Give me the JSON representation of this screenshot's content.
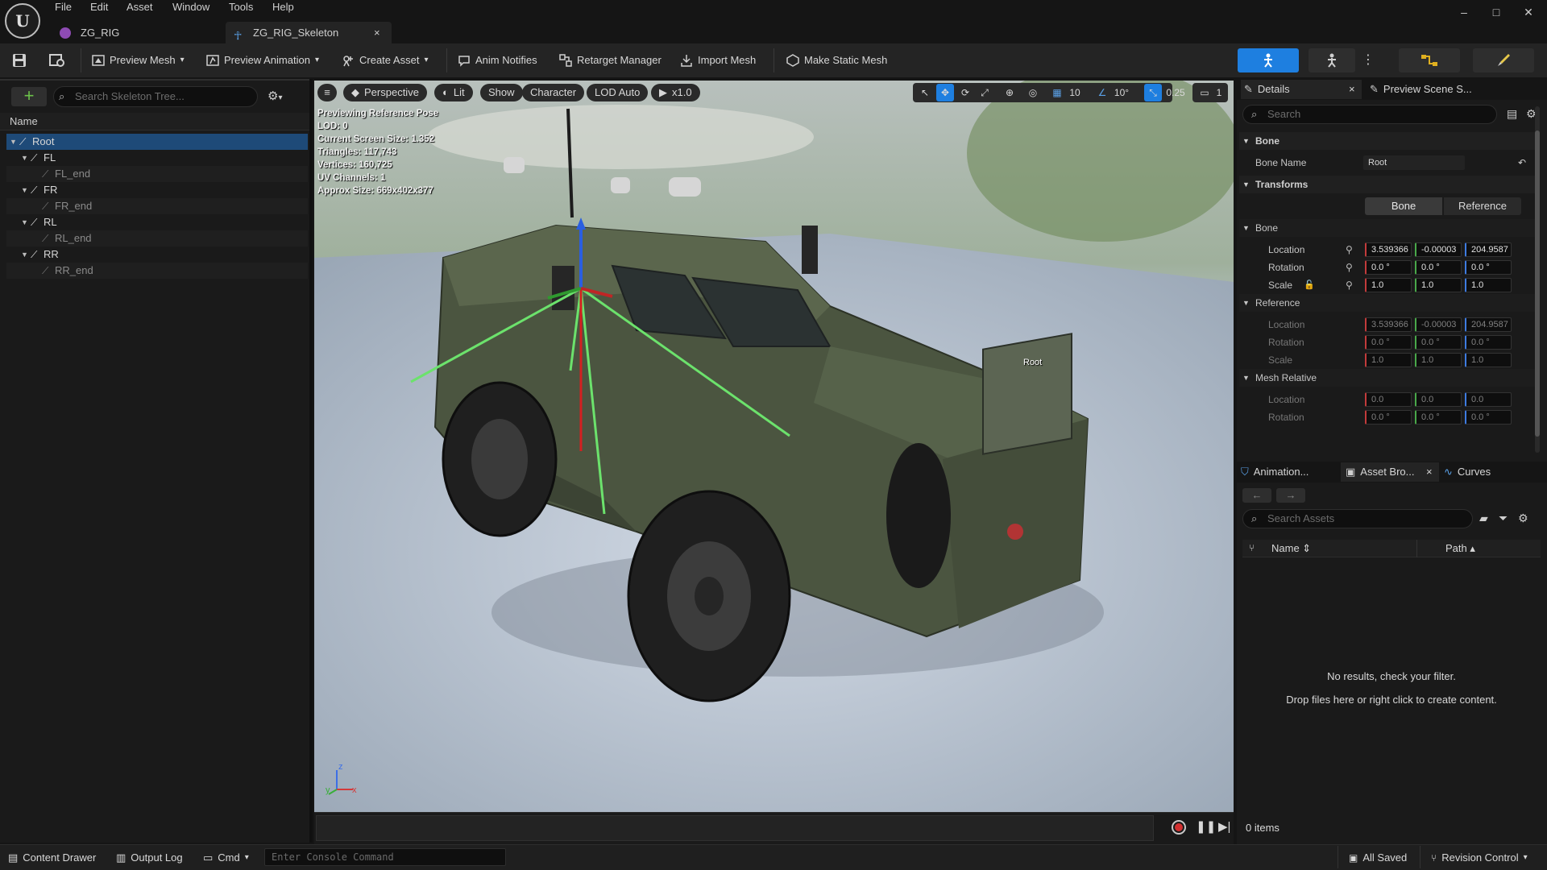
{
  "app": {
    "menu": [
      "File",
      "Edit",
      "Asset",
      "Window",
      "Tools",
      "Help"
    ],
    "tabs": [
      {
        "label": "ZG_RIG"
      },
      {
        "label": "ZG_RIG_Skeleton",
        "close": "×"
      }
    ],
    "window_controls": {
      "minimize": "–",
      "maximize": "□",
      "close": "✕"
    }
  },
  "toolbar": {
    "preview_mesh": "Preview Mesh",
    "preview_animation": "Preview Animation",
    "create_asset": "Create Asset",
    "anim_notifies": "Anim Notifies",
    "retarget_manager": "Retarget Manager",
    "import_mesh": "Import Mesh",
    "make_static_mesh": "Make Static Mesh",
    "accent_color": "#1e7fe0"
  },
  "skeleton_tree": {
    "search_placeholder": "Search Skeleton Tree...",
    "column": "Name",
    "bones": [
      {
        "label": "Root",
        "level": 0,
        "end": false
      },
      {
        "label": "FL",
        "level": 1,
        "end": false
      },
      {
        "label": "FL_end",
        "level": 2,
        "end": true
      },
      {
        "label": "FR",
        "level": 1,
        "end": false
      },
      {
        "label": "FR_end",
        "level": 2,
        "end": true
      },
      {
        "label": "RL",
        "level": 1,
        "end": false
      },
      {
        "label": "RL_end",
        "level": 2,
        "end": true
      },
      {
        "label": "RR",
        "level": 1,
        "end": false
      },
      {
        "label": "RR_end",
        "level": 2,
        "end": true
      }
    ]
  },
  "viewport": {
    "view_mode": "Perspective",
    "lighting": "Lit",
    "show": "Show",
    "character": "Character",
    "lod": "LOD Auto",
    "speed": "x1.0",
    "grid_value": "10",
    "angle_value": "10°",
    "scale_value": "0.25",
    "camera_value": "1",
    "stats": [
      "Previewing Reference Pose",
      "LOD: 0",
      "Current Screen Size: 1.352",
      "Triangles: 117,743",
      "Vertices: 160,725",
      "UV Channels: 1",
      "Approx Size: 669x402x377"
    ],
    "bone_label": "Root",
    "axis_labels": {
      "z": "z",
      "x": "x",
      "y": "y"
    }
  },
  "details": {
    "tab_label": "Details",
    "tab2_label": "Preview Scene S...",
    "search_placeholder": "Search",
    "bone_section": "Bone",
    "bone_name_label": "Bone Name",
    "bone_name_value": "Root",
    "transforms_section": "Transforms",
    "toggle_bone": "Bone",
    "toggle_reference": "Reference",
    "groups": [
      {
        "title": "Bone",
        "dim": false,
        "rows": [
          {
            "label": "Location",
            "values": [
              "3.539366",
              "-0.00003",
              "204.9587"
            ]
          },
          {
            "label": "Rotation",
            "values": [
              "0.0 °",
              "0.0 °",
              "0.0 °"
            ]
          },
          {
            "label": "Scale",
            "values": [
              "1.0",
              "1.0",
              "1.0"
            ]
          }
        ]
      },
      {
        "title": "Reference",
        "dim": true,
        "rows": [
          {
            "label": "Location",
            "values": [
              "3.539366",
              "-0.00003",
              "204.9587"
            ]
          },
          {
            "label": "Rotation",
            "values": [
              "0.0 °",
              "0.0 °",
              "0.0 °"
            ]
          },
          {
            "label": "Scale",
            "values": [
              "1.0",
              "1.0",
              "1.0"
            ]
          }
        ]
      },
      {
        "title": "Mesh Relative",
        "dim": true,
        "rows": [
          {
            "label": "Location",
            "values": [
              "0.0",
              "0.0",
              "0.0"
            ]
          },
          {
            "label": "Rotation",
            "values": [
              "0.0 °",
              "0.0 °",
              "0.0 °"
            ]
          }
        ]
      }
    ]
  },
  "asset_panel": {
    "tabs": [
      "Animation...",
      "Asset Bro...",
      "Curves"
    ],
    "close": "×",
    "search_placeholder": "Search Assets",
    "col_name": "Name",
    "col_path": "Path",
    "empty_line1": "No results, check your filter.",
    "empty_line2": "Drop files here or right click to create content.",
    "count": "0 items"
  },
  "status_bar": {
    "content_drawer": "Content Drawer",
    "output_log": "Output Log",
    "cmd": "Cmd",
    "console_placeholder": "Enter Console Command",
    "all_saved": "All Saved",
    "revision_control": "Revision Control"
  }
}
